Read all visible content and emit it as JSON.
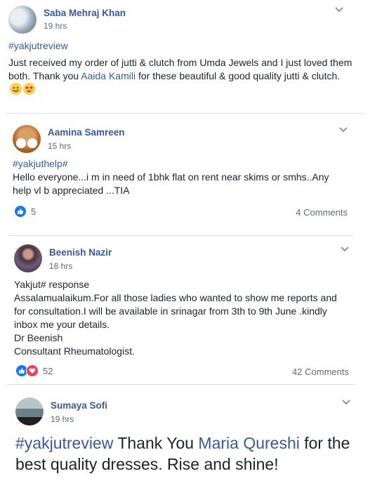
{
  "posts": [
    {
      "author": "Saba Mehraj Khan",
      "time": "19 hrs",
      "hashtag": "#yakjutreview",
      "text_before": "Just received my order of jutti & clutch from Umda Jewels and I just loved them both. Thank you ",
      "mention": "Aaida Kamili",
      "text_after": " for these beautiful & good quality jutti & clutch.",
      "emojis": [
        "smiling-face",
        "star-struck-face"
      ]
    },
    {
      "author": "Aamina Samreen",
      "time": "15 hrs",
      "hashtag": "#yakjuthelp#",
      "text": "Hello everyone...i m in need of 1bhk flat on rent near skims or smhs..Any help vl b appreciated ...TIA",
      "reactions": {
        "types": [
          "like"
        ],
        "count": "5"
      },
      "comments": "4 Comments"
    },
    {
      "author": "Beenish Nazir",
      "time": "18 hrs",
      "lines": [
        "Yakjut# response",
        "Assalamualaikum.For all those ladies who wanted to show me reports and",
        "for consultation.I will be available in srinagar from 3th to 9th June .kindly",
        "inbox me your details.",
        "Dr Beenish",
        "Consultant Rheumatologist."
      ],
      "reactions": {
        "types": [
          "like",
          "love"
        ],
        "count": "52"
      },
      "comments": "42 Comments"
    },
    {
      "author": "Sumaya Sofi",
      "time": "19 hrs",
      "hashtag": "#yakjutreview",
      "text_before": " Thank You ",
      "mention": "Maria Qureshi",
      "text_after": " for the best quality dresses. Rise and shine!"
    }
  ],
  "colors": {
    "link": "#385898",
    "like": "#1877f2",
    "love": "#f33e58",
    "meta": "#606770"
  }
}
